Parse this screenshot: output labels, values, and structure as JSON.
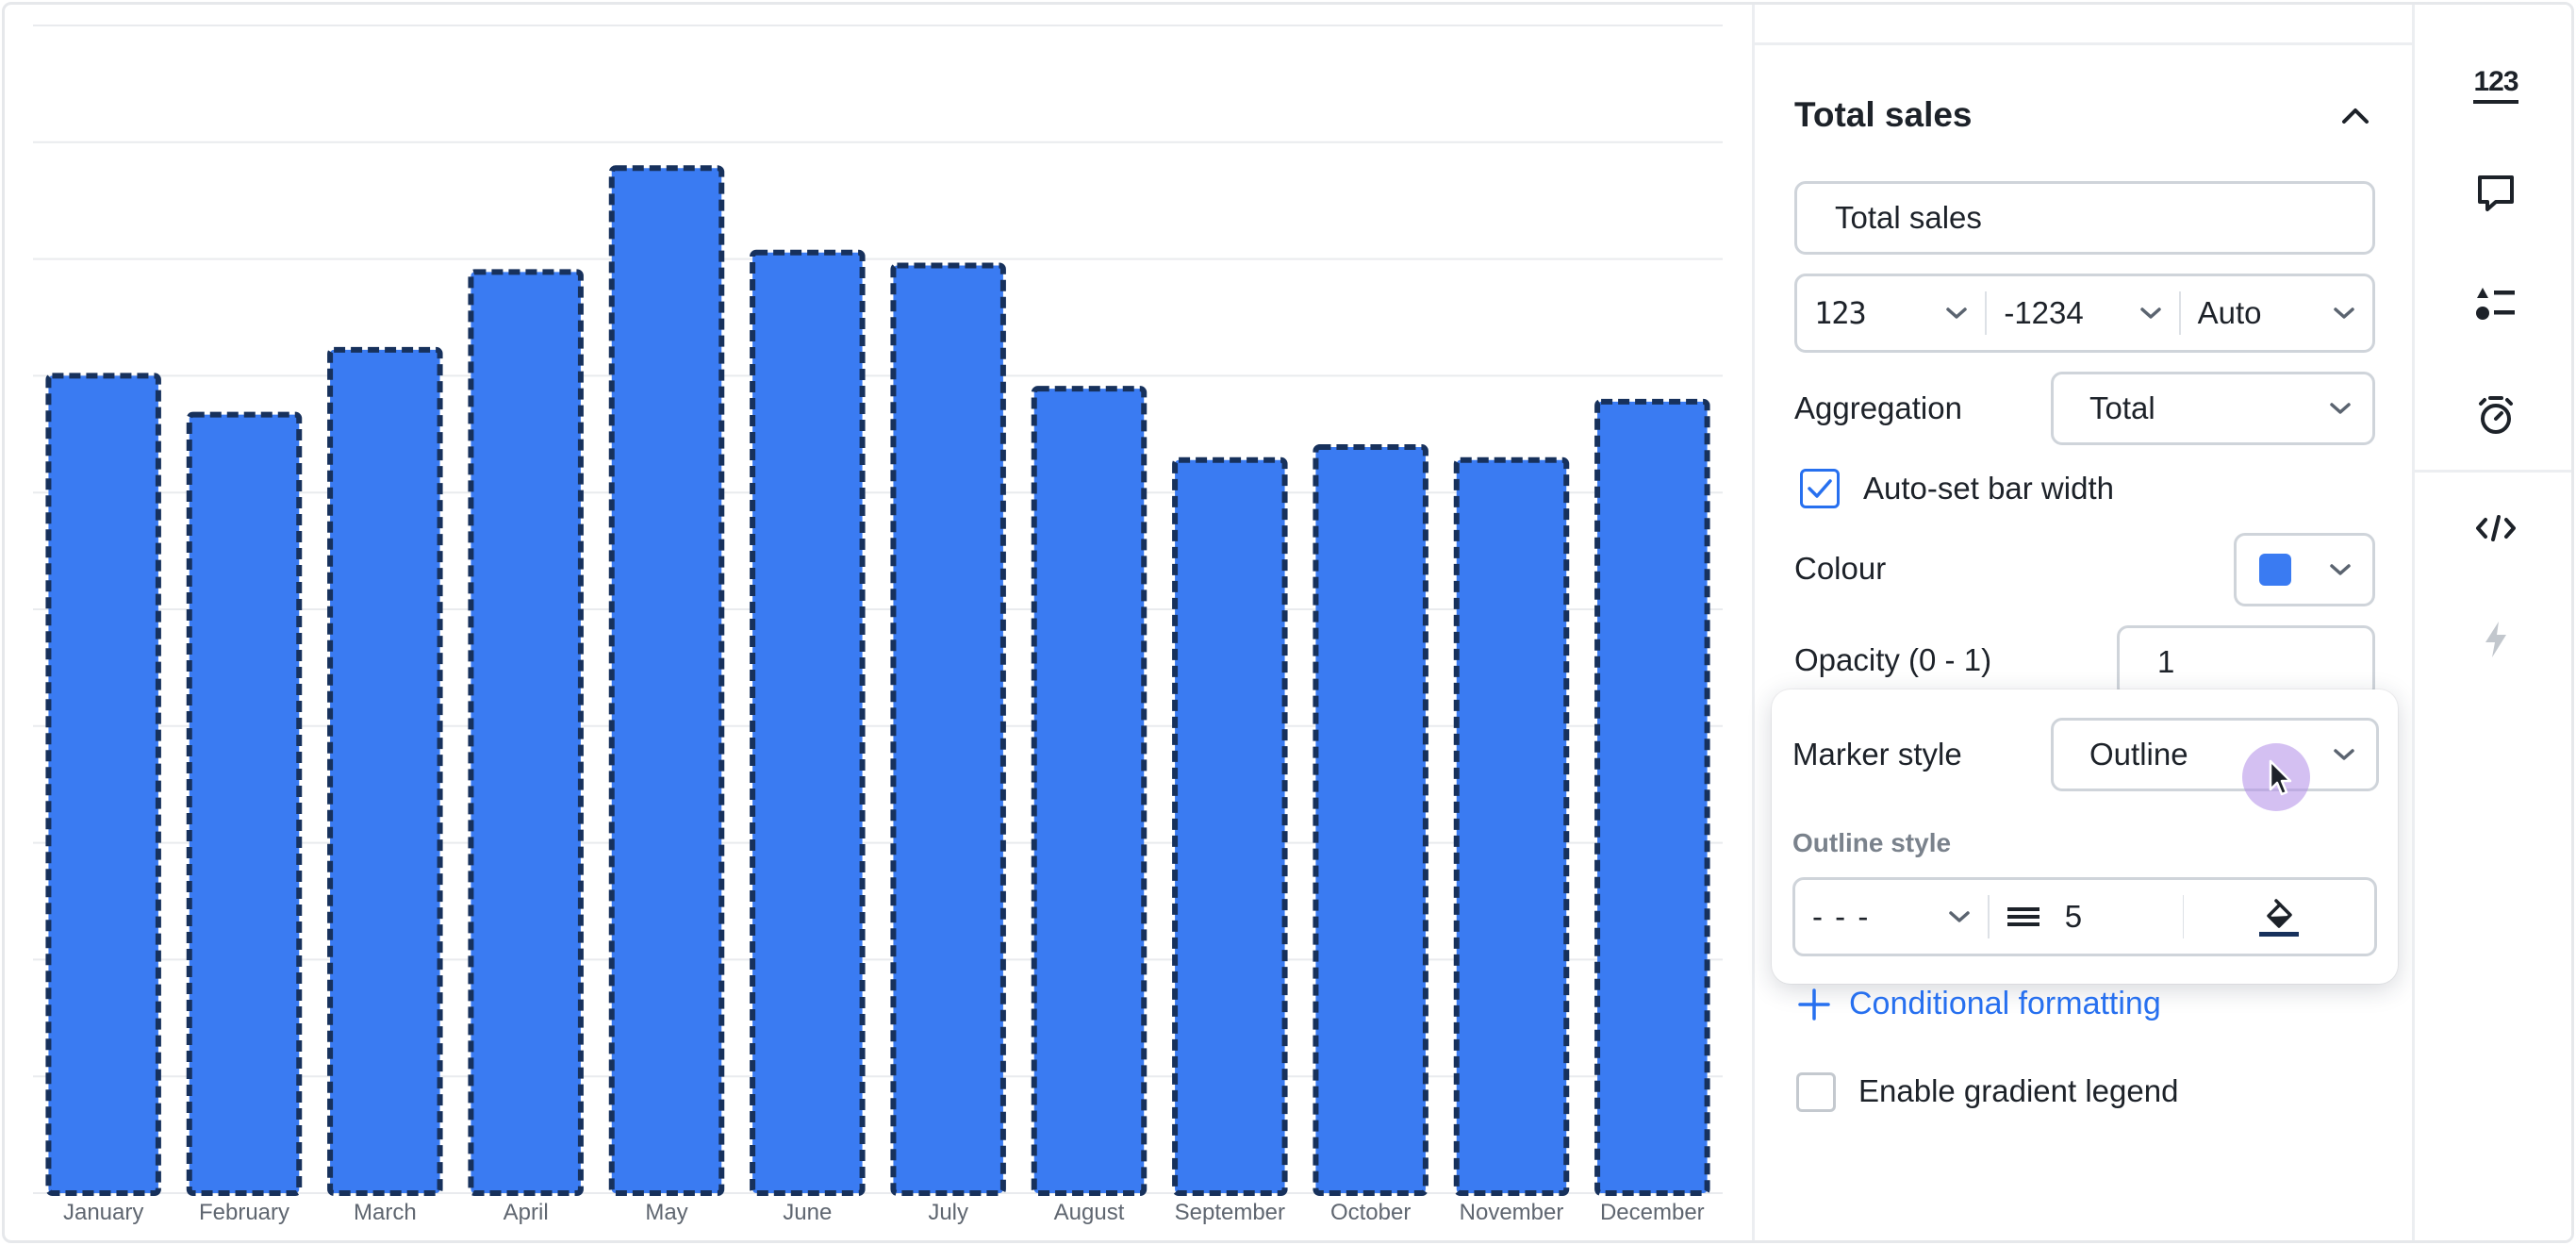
{
  "chart_data": {
    "type": "bar",
    "categories": [
      "January",
      "February",
      "March",
      "April",
      "May",
      "June",
      "July",
      "August",
      "September",
      "October",
      "November",
      "December"
    ],
    "values": [
      63,
      60,
      65,
      71,
      79,
      72.5,
      71.5,
      62,
      56.5,
      57.5,
      56.5,
      61
    ],
    "ylim": [
      0,
      90
    ],
    "gridlines": 10,
    "bar_color": "#3a7bf2",
    "outline_color": "#17315c",
    "outline_style": "dashed",
    "grid": true
  },
  "panel": {
    "section_title": "Total sales",
    "name_value": "Total sales",
    "format": {
      "number_icon": "123",
      "negative_format": "-1234",
      "units": "Auto"
    },
    "aggregation": {
      "label": "Aggregation",
      "value": "Total"
    },
    "auto_bar_width": {
      "label": "Auto-set bar width",
      "checked": true
    },
    "colour": {
      "label": "Colour",
      "value": "#3a7bf2"
    },
    "opacity": {
      "label": "Opacity (0 - 1)",
      "value": "1"
    },
    "conditional_formatting": "Conditional formatting",
    "gradient_legend": {
      "label": "Enable gradient legend",
      "checked": false
    }
  },
  "popover": {
    "marker_style_label": "Marker style",
    "marker_style_value": "Outline",
    "outline_style_label": "Outline style",
    "line_style_value": "- - -",
    "line_width_value": "5",
    "line_color": "#17315c"
  },
  "rail": {
    "numbers_icon_text": "123",
    "items": [
      "numbers-icon",
      "comment-icon",
      "list-settings-icon",
      "alert-icon",
      "embed-code-icon",
      "lightning-icon"
    ]
  },
  "colors": {
    "accent": "#2770ef",
    "border": "#cfd4da"
  }
}
